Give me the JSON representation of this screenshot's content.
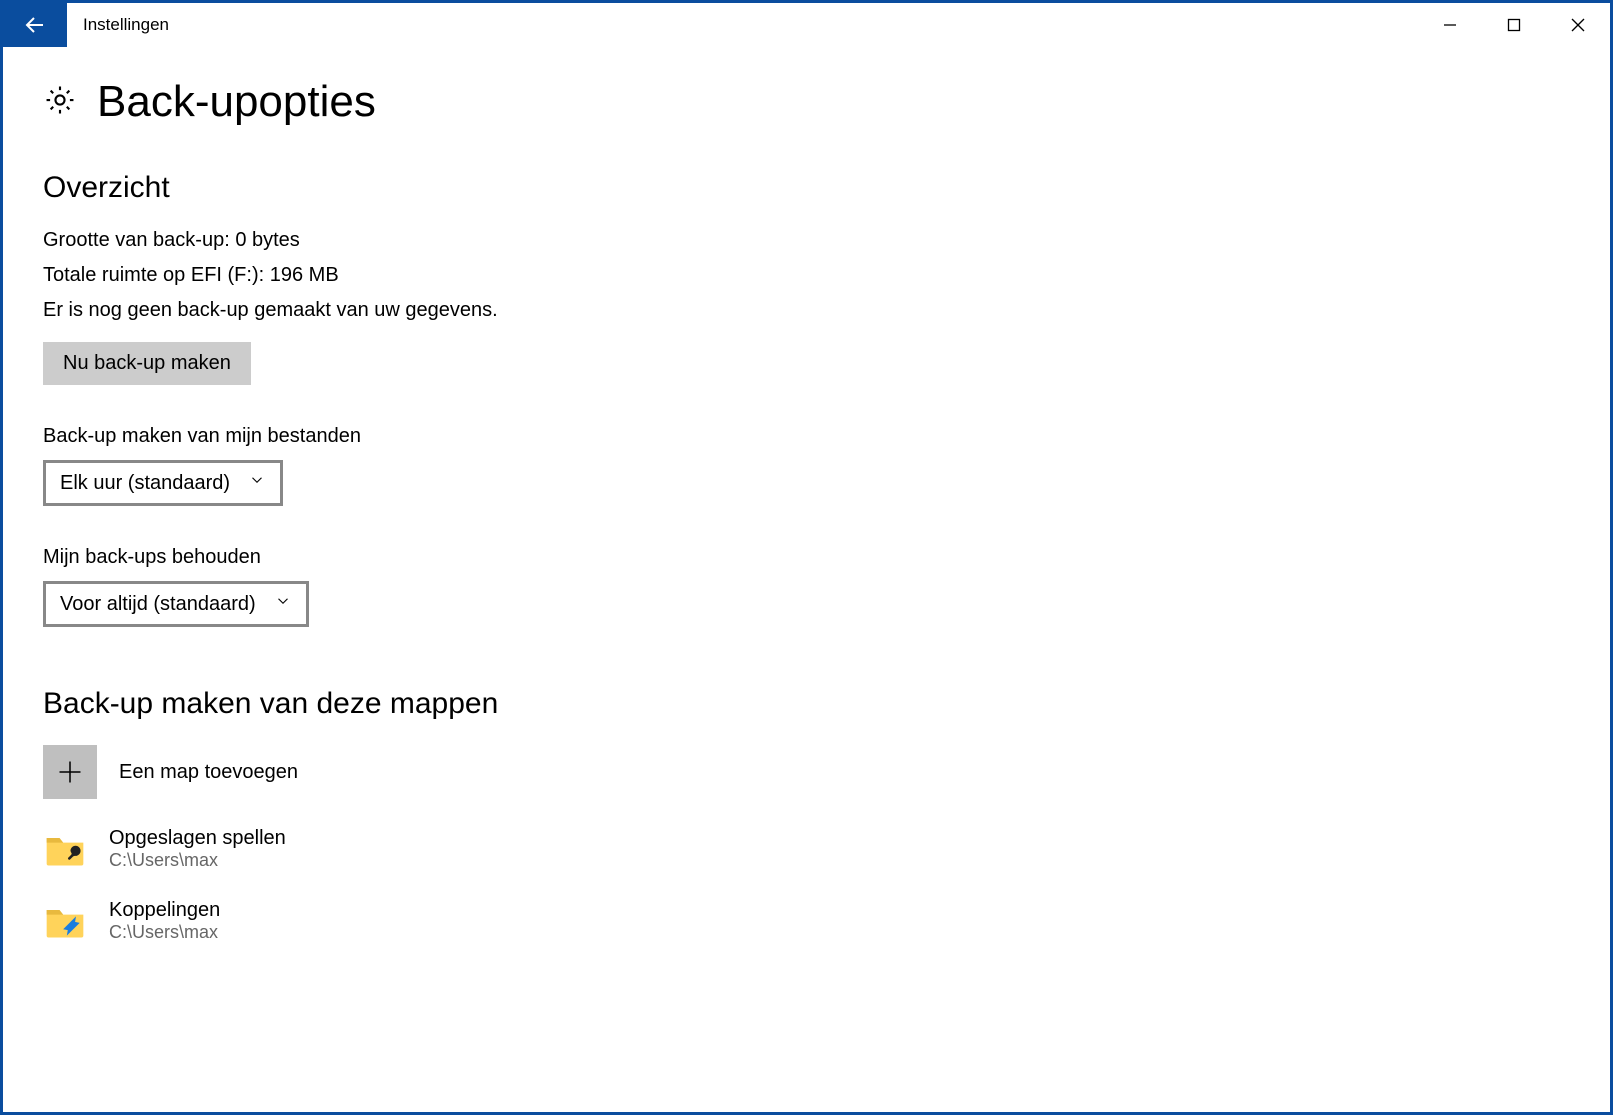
{
  "window": {
    "title": "Instellingen"
  },
  "page": {
    "title": "Back-upopties"
  },
  "overview": {
    "heading": "Overzicht",
    "size_line": "Grootte van back-up: 0 bytes",
    "space_line": "Totale ruimte op EFI (F:): 196 MB",
    "status_line": "Er is nog geen back-up gemaakt van uw gegevens.",
    "backup_now_label": "Nu back-up maken"
  },
  "frequency": {
    "label": "Back-up maken van mijn bestanden",
    "selected": "Elk uur (standaard)"
  },
  "retention": {
    "label": "Mijn back-ups behouden",
    "selected": "Voor altijd (standaard)"
  },
  "folders": {
    "heading": "Back-up maken van deze mappen",
    "add_label": "Een map toevoegen",
    "items": [
      {
        "name": "Opgeslagen spellen",
        "path": "C:\\Users\\max"
      },
      {
        "name": "Koppelingen",
        "path": "C:\\Users\\max"
      }
    ]
  }
}
